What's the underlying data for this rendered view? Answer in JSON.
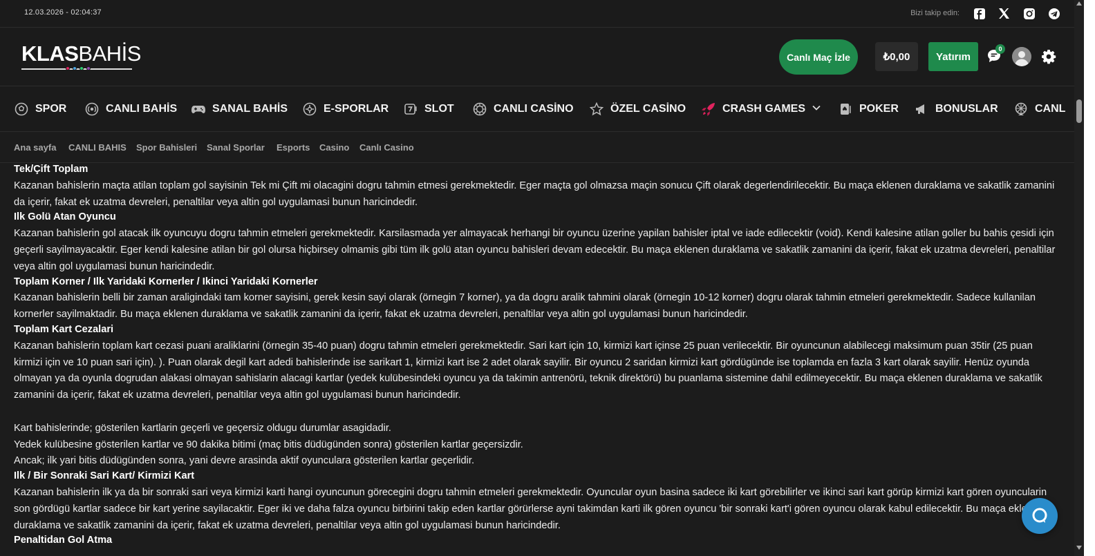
{
  "topbar": {
    "datetime": "12.03.2026 - 02:04:37",
    "follow_label": "Bizi takip edin:",
    "socials": [
      "facebook-icon",
      "x-icon",
      "instagram-icon",
      "telegram-icon"
    ]
  },
  "header": {
    "logo_bold": "KLAS",
    "logo_light": "BAHİS",
    "logo_dot_colors": [
      "#e0245e",
      "#4aa3df",
      "#2ecc71",
      "#8e44ad"
    ],
    "live_button": "Canlı Maç İzle",
    "balance": "₺0,00",
    "deposit_button": "Yatırım",
    "chat_badge": "0",
    "accent_color": "#1f8a4c"
  },
  "nav": {
    "items": [
      {
        "label": "SPOR",
        "icon": "soccer-ball-icon"
      },
      {
        "label": "CANLI BAHİS",
        "icon": "live-signal-icon"
      },
      {
        "label": "SANAL BAHİS",
        "icon": "gamepad-icon"
      },
      {
        "label": "E-SPORLAR",
        "icon": "esports-icon"
      },
      {
        "label": "SLOT",
        "icon": "slot-seven-icon"
      },
      {
        "label": "CANLI CASİNO",
        "icon": "roulette-icon"
      },
      {
        "label": "ÖZEL CASİNO",
        "icon": "star-icon"
      },
      {
        "label": "CRASH GAMES",
        "icon": "rocket-icon"
      },
      {
        "label": "POKER",
        "icon": "poker-card-icon"
      },
      {
        "label": "BONUSLAR",
        "icon": "megaphone-icon"
      },
      {
        "label": "CANL",
        "icon": "wheel-icon"
      }
    ]
  },
  "breadcrumbs": [
    "Ana sayfa",
    "CANLI BAHIS",
    "Spor Bahisleri",
    "Sanal Sporlar",
    "Esports",
    "Casino",
    "Canlı Casino"
  ],
  "content": {
    "h1": "Tek/Çift Toplam",
    "p1": "Kazanan bahislerin maçta atilan toplam gol sayisinin Tek mi Çift mi olacagini dogru tahmin etmesi gerekmektedir. Eger maçta gol olmazsa maçin sonucu Çift olarak degerlendirilecektir. Bu maça eklenen duraklama ve sakatlik zamanini da içerir, fakat ek uzatma devreleri, penaltilar veya altin gol uygulamasi bunun haricindedir.",
    "h2": "Ilk Golü Atan Oyuncu",
    "p2": "Kazanan bahislerin gol atacak ilk oyuncuyu dogru tahmin etmeleri gerekmektedir. Karsilasmada yer almayacak herhangi bir oyuncu üzerine yapilan bahisler iptal ve iade edilecektir (void). Kendi kalesine atilan goller bu bahis çesidi için geçerli sayilmayacaktir. Eger kendi kalesine atilan bir gol olursa hiçbirsey olmamis gibi tüm ilk golü atan oyuncu bahisleri devam edecektir. Bu maça eklenen duraklama ve sakatlik zamanini da içerir, fakat ek uzatma devreleri, penaltilar veya altin gol uygulamasi bunun haricindedir.",
    "h3": "Toplam Korner / Ilk Yaridaki Kornerler / Ikinci Yaridaki Kornerler",
    "p3": "Kazanan bahislerin belli bir zaman araligindaki tam korner sayisini, gerek kesin sayi olarak (örnegin 7 korner), ya da dogru aralik tahmini olarak (örnegin 10-12 korner) dogru olarak tahmin etmeleri gerekmektedir. Sadece kullanilan kornerler sayilmaktadir. Bu maça eklenen duraklama ve sakatlik zamanini da içerir, fakat ek uzatma devreleri, penaltilar veya altin gol uygulamasi bunun haricindedir.",
    "h4": "Toplam Kart Cezalari",
    "p4": "Kazanan bahislerin toplam kart cezasi puani araliklarini (örnegin 35-40 puan) dogru tahmin etmeleri gerekmektedir. Sari kart için 10, kirmizi kart içinse 25 puan verilecektir. Bir oyuncunun alabilecegi maksimum puan 35tir (25 puan kirmizi için ve 10 puan sari için). ). Puan olarak degil kart adedi bahislerinde ise sarikart 1, kirmizi kart ise 2 adet olarak sayilir. Bir oyuncu 2 saridan kirmizi kart gördügünde ise toplamda en fazla 3 kart olarak sayilir. Henüz oyunda olmayan ya da oyunla dogrudan alakasi olmayan sahislarin alacagi kartlar (yedek kulübesindeki oyuncu ya da takimin antrenörü, teknik direktörü) bu puanlama sistemine dahil edilmeyecektir. Bu maça eklenen duraklama ve sakatlik zamanini da içerir, fakat ek uzatma devreleri, penaltilar veya altin gol uygulamasi bunun haricindedir.",
    "p5": "Kart bahislerinde; gösterilen kartlarin geçerli ve geçersiz oldugu durumlar asagidadir.",
    "p6": "Yedek kulübesine gösterilen kartlar ve 90 dakika bitimi (maç bitis düdügünden sonra) gösterilen kartlar geçersizdir.",
    "p7": "Ancak; ilk yari bitis düdügünden sonra, yani devre arasinda aktif oyunculara gösterilen kartlar geçerlidir.",
    "h5": "Ilk / Bir Sonraki Sari Kart/ Kirmizi Kart",
    "p8": "Kazanan bahislerin ilk ya da bir sonraki sari veya kirmizi karti hangi oyuncunun görecegini dogru tahmin etmeleri gerekmektedir. Oyuncular oyun basina sadece iki kart görebilirler ve ikinci sari kart görüp kirmizi kart gören oyuncularin son gördügü kartlar sadece bir kart yerine sayilacaktir. Eger iki ve daha falza oyuncu birbirini takip eden kartlar görürlerse ayni takimdan karti ilk gören oyuncu 'bir sonraki kart'i gören oyuncu olarak kabul edilecektir. Bu maça eklenen duraklama ve sakatlik zamanini da içerir, fakat ek uzatma devreleri, penaltilar veya altin gol uygulamasi bunun haricindedir.",
    "h6": "Penaltidan Gol Atma"
  }
}
